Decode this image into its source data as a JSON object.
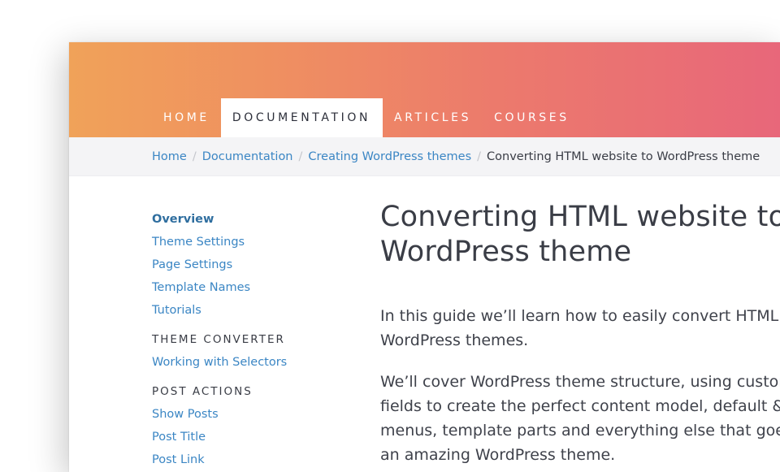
{
  "nav": {
    "items": [
      {
        "label": "HOME"
      },
      {
        "label": "DOCUMENTATION",
        "active": true
      },
      {
        "label": "ARTICLES"
      },
      {
        "label": "COURSES"
      }
    ]
  },
  "breadcrumb": {
    "items": [
      "Home",
      "Documentation",
      "Creating WordPress themes"
    ],
    "separator": "/",
    "current": "Converting HTML website to WordPress theme"
  },
  "sidebar": {
    "links": [
      "Overview",
      "Theme Settings",
      "Page Settings",
      "Template Names",
      "Tutorials"
    ],
    "sections": [
      {
        "heading": "THEME CONVERTER",
        "links": [
          "Working with Selectors"
        ]
      },
      {
        "heading": "POST ACTIONS",
        "links": [
          "Show Posts",
          "Post Title",
          "Post Link"
        ]
      }
    ]
  },
  "main": {
    "title_line1": "Converting HTML website to",
    "title_line2": "WordPress theme",
    "paragraph1": [
      "In this guide we’ll learn how to easily convert HTML web",
      "WordPress themes."
    ],
    "paragraph2": [
      "We’ll cover WordPress theme structure, using custom p",
      "fields to create the perfect content model, default & cus",
      "menus, template parts and everything else that goes in",
      "an amazing WordPress theme."
    ]
  },
  "colors": {
    "gradient_start": "#f0a259",
    "gradient_end": "#e8677a",
    "link": "#3b86c4",
    "text": "#3a3d46"
  }
}
